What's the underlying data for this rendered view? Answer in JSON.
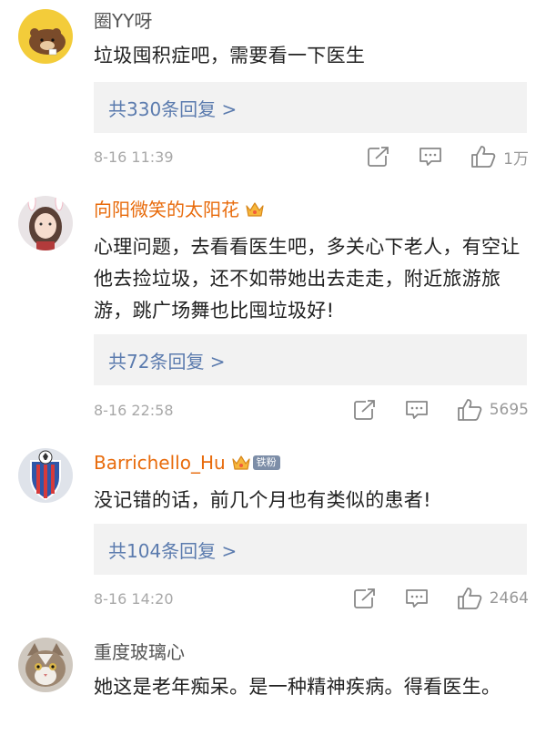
{
  "comments": [
    {
      "username": "圈YY呀",
      "vip": false,
      "content": "垃圾囤积症吧，需要看一下医生",
      "replies": "共330条回复 >",
      "time": "8-16 11:39",
      "likes": "1万",
      "avatar_icon": "bear-avatar-icon"
    },
    {
      "username": "向阳微笑的太阳花",
      "vip": true,
      "content": "心理问题，去看看医生吧，多关心下老人，有空让他去捡垃圾，还不如带她出去走走，附近旅游旅游，跳广场舞也比囤垃圾好!",
      "replies": "共72条回复 >",
      "time": "8-16 22:58",
      "likes": "5695",
      "avatar_icon": "girl-avatar-icon"
    },
    {
      "username": "Barrichello_Hu",
      "vip": true,
      "badge": "铁粉",
      "content": "没记错的话，前几个月也有类似的患者!",
      "replies": "共104条回复 >",
      "time": "8-16 14:20",
      "likes": "2464",
      "avatar_icon": "football-club-avatar-icon"
    },
    {
      "username": "重度玻璃心",
      "vip": false,
      "content": "她这是老年痴呆。是一种精神疾病。得看医生。",
      "avatar_icon": "cat-avatar-icon"
    }
  ],
  "colors": {
    "link_blue": "#5b7bae",
    "vip_orange": "#e86b0c",
    "reply_bg": "#f2f2f2",
    "meta_gray": "#a8a8a8"
  }
}
